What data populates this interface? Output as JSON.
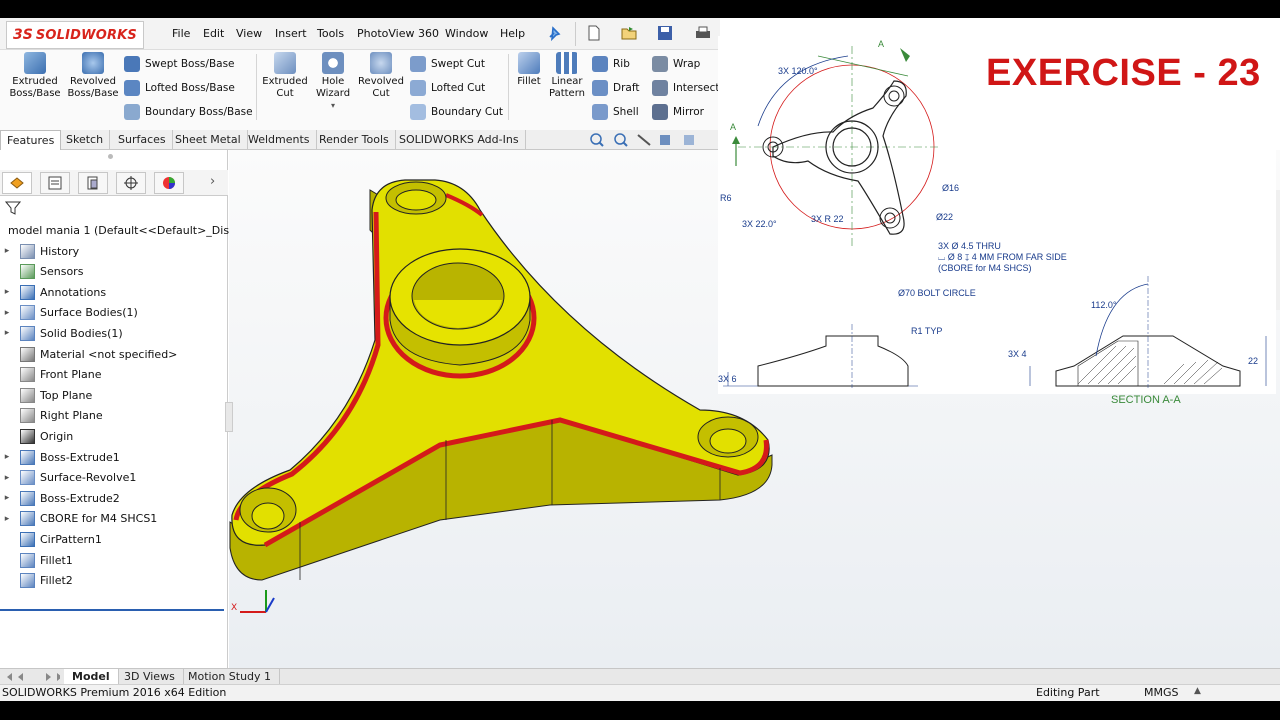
{
  "app": {
    "name": "SOLIDWORKS",
    "logo_mark": "3S"
  },
  "menu": [
    "File",
    "Edit",
    "View",
    "Insert",
    "Tools",
    "PhotoView 360",
    "Window",
    "Help"
  ],
  "commands": {
    "extruded_boss": "Extruded\nBoss/Base",
    "revolved_boss": "Revolved\nBoss/Base",
    "swept_boss": "Swept Boss/Base",
    "lofted_boss": "Lofted Boss/Base",
    "boundary_boss": "Boundary Boss/Base",
    "extruded_cut": "Extruded\nCut",
    "hole_wizard": "Hole\nWizard",
    "revolved_cut": "Revolved\nCut",
    "swept_cut": "Swept Cut",
    "lofted_cut": "Lofted Cut",
    "boundary_cut": "Boundary Cut",
    "fillet": "Fillet",
    "linear_pattern": "Linear\nPattern",
    "rib": "Rib",
    "draft": "Draft",
    "shell": "Shell",
    "wrap": "Wrap",
    "intersect": "Intersect",
    "mirror": "Mirror"
  },
  "cm_tabs": [
    "Features",
    "Sketch",
    "Surfaces",
    "Sheet Metal",
    "Weldments",
    "Render Tools",
    "SOLIDWORKS Add-Ins"
  ],
  "feature_tree": {
    "root": "model mania 1  (Default<<Default>_Disp",
    "items": [
      {
        "label": "History",
        "expand": true
      },
      {
        "label": "Sensors",
        "expand": false
      },
      {
        "label": "Annotations",
        "expand": true
      },
      {
        "label": "Surface Bodies(1)",
        "expand": true
      },
      {
        "label": "Solid Bodies(1)",
        "expand": true
      },
      {
        "label": "Material <not specified>",
        "expand": false
      },
      {
        "label": "Front Plane",
        "expand": false
      },
      {
        "label": "Top Plane",
        "expand": false
      },
      {
        "label": "Right Plane",
        "expand": false
      },
      {
        "label": "Origin",
        "expand": false
      },
      {
        "label": "Boss-Extrude1",
        "expand": true
      },
      {
        "label": "Surface-Revolve1",
        "expand": true
      },
      {
        "label": "Boss-Extrude2",
        "expand": true
      },
      {
        "label": "CBORE for M4 SHCS1",
        "expand": true
      },
      {
        "label": "CirPattern1",
        "expand": false
      },
      {
        "label": "Fillet1",
        "expand": false
      },
      {
        "label": "Fillet2",
        "expand": false
      }
    ]
  },
  "bottom_tabs": [
    "Model",
    "3D Views",
    "Motion Study 1"
  ],
  "status": {
    "edition": "SOLIDWORKS Premium 2016 x64 Edition",
    "mode": "Editing Part",
    "units": "MMGS"
  },
  "drawing": {
    "title": "EXERCISE - 23",
    "dims": {
      "angle_pattern": "3X 120.0°",
      "section_letter": "A",
      "r6": "R6",
      "d16": "Ø16",
      "d22": "Ø22",
      "ang22": "3X 22.0°",
      "r22": "3X R 22",
      "hole1": "3X  Ø 4.5 THRU",
      "hole2": "⌴ Ø 8 ↧ 4 MM FROM FAR SIDE",
      "hole3": "(CBORE for M4 SHCS)",
      "bolt": "Ø70 BOLT CIRCLE",
      "r1": "R1 TYP",
      "t6": "3X 6",
      "t4": "3X 4",
      "ang112": "112.0°",
      "h22": "22",
      "section": "SECTION A-A"
    }
  },
  "colors": {
    "part_yellow": "#e2e000",
    "edge_red": "#d41a1a",
    "brand_red": "#d8241c",
    "exercise_red": "#d01616",
    "dim_blue": "#1a3c8c"
  }
}
